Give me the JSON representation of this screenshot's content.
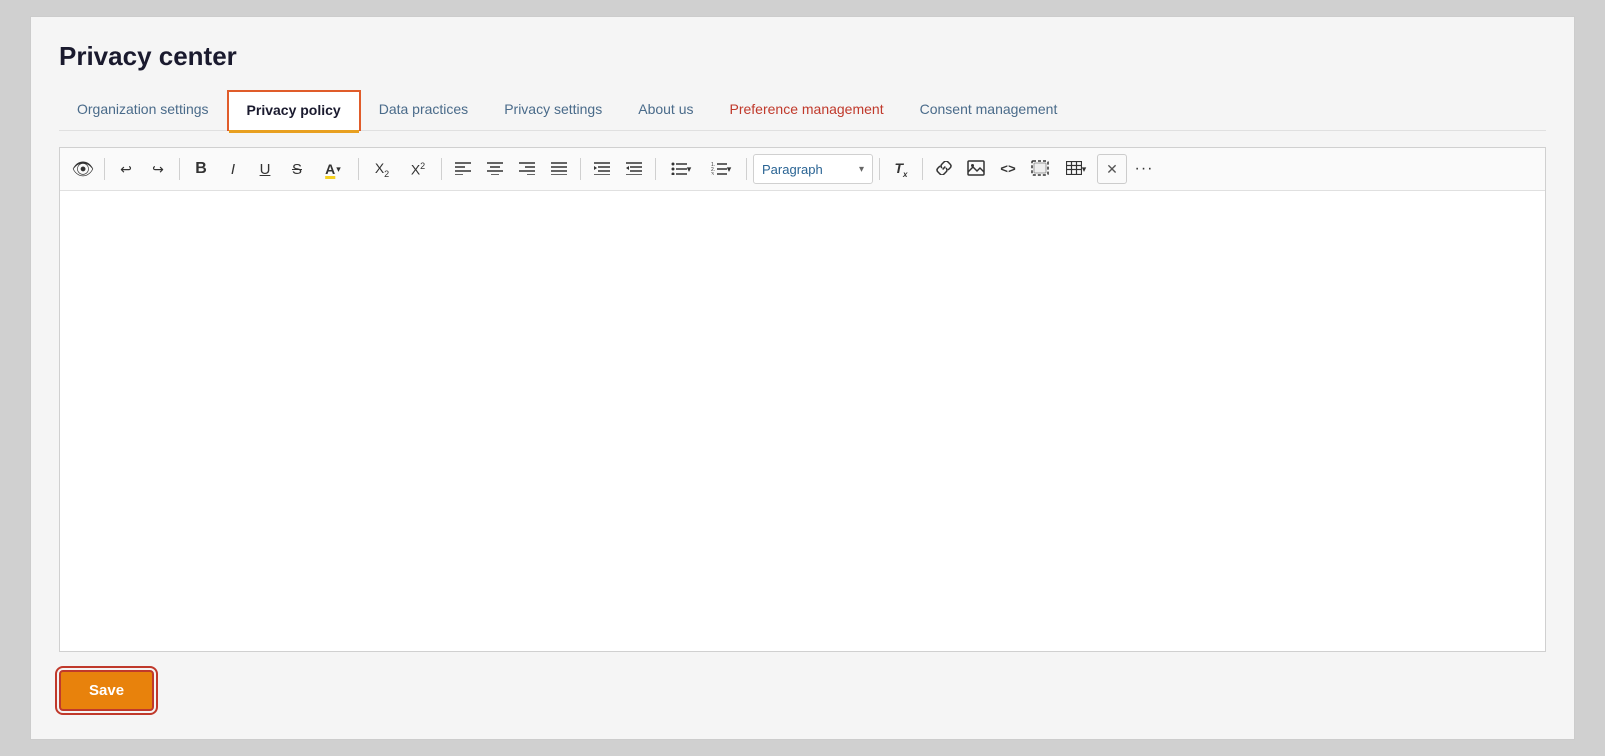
{
  "app": {
    "title": "Privacy center"
  },
  "tabs": [
    {
      "id": "org-settings",
      "label": "Organization settings",
      "active": false,
      "orange": false
    },
    {
      "id": "privacy-policy",
      "label": "Privacy policy",
      "active": true,
      "orange": false
    },
    {
      "id": "data-practices",
      "label": "Data practices",
      "active": false,
      "orange": false
    },
    {
      "id": "privacy-settings",
      "label": "Privacy settings",
      "active": false,
      "orange": false
    },
    {
      "id": "about-us",
      "label": "About us",
      "active": false,
      "orange": false
    },
    {
      "id": "preference-management",
      "label": "Preference management",
      "active": false,
      "orange": true
    },
    {
      "id": "consent-management",
      "label": "Consent management",
      "active": false,
      "orange": false
    }
  ],
  "toolbar": {
    "preview_title": "Preview",
    "undo_title": "Undo",
    "redo_title": "Redo",
    "bold_label": "B",
    "italic_label": "I",
    "underline_label": "U",
    "strikethrough_label": "S",
    "highlight_label": "A",
    "subscript_label": "X",
    "subscript_suffix": "2",
    "superscript_label": "X",
    "superscript_suffix": "2",
    "align_left": "≡",
    "align_center": "≡",
    "align_right": "≡",
    "align_justify": "≡",
    "indent_increase": "indent+",
    "indent_decrease": "indent-",
    "bullet_list": "list",
    "ordered_list": "list-ol",
    "paragraph_label": "Paragraph",
    "clear_format_label": "Tx",
    "link_label": "link",
    "image_label": "img",
    "code_label": "<>",
    "block_label": "block",
    "table_label": "table",
    "clear_label": "✕",
    "more_label": "•••"
  },
  "editor": {
    "content": "",
    "placeholder": ""
  },
  "actions": {
    "save_label": "Save"
  },
  "colors": {
    "accent_orange": "#e8820c",
    "active_border": "#e05c2a",
    "active_underline": "#e8a020",
    "orange_tab": "#c0392b",
    "link_color": "#2a6494"
  }
}
